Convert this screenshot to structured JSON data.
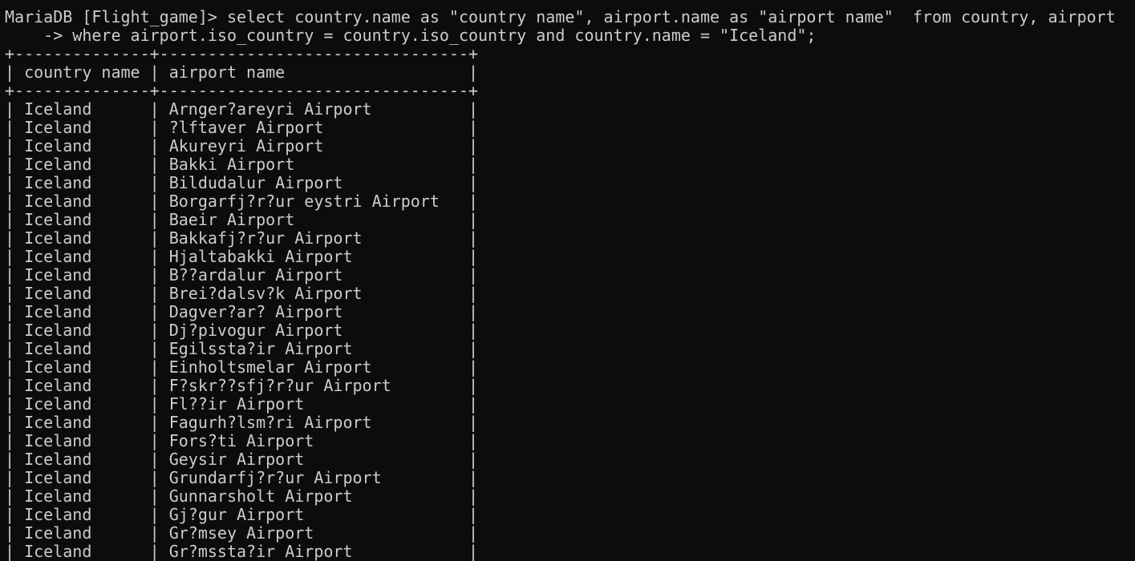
{
  "terminal": {
    "prompt": "MariaDB [Flight_game]>",
    "command_line1": "select country.name as \"country name\", airport.name as \"airport name\"  from country, airport",
    "continuation_prompt": "    ->",
    "command_line2": "where airport.iso_country = country.iso_country and country.name = \"Iceland\";"
  },
  "table": {
    "border": "+--------------+--------------------------------+",
    "headers": [
      "country name",
      "airport name"
    ],
    "rows": [
      [
        "Iceland",
        "Arnger?areyri Airport"
      ],
      [
        "Iceland",
        "?lftaver Airport"
      ],
      [
        "Iceland",
        "Akureyri Airport"
      ],
      [
        "Iceland",
        "Bakki Airport"
      ],
      [
        "Iceland",
        "Bildudalur Airport"
      ],
      [
        "Iceland",
        "Borgarfj?r?ur eystri Airport"
      ],
      [
        "Iceland",
        "Baeir Airport"
      ],
      [
        "Iceland",
        "Bakkafj?r?ur Airport"
      ],
      [
        "Iceland",
        "Hjaltabakki Airport"
      ],
      [
        "Iceland",
        "B??ardalur Airport"
      ],
      [
        "Iceland",
        "Brei?dalsv?k Airport"
      ],
      [
        "Iceland",
        "Dagver?ar? Airport"
      ],
      [
        "Iceland",
        "Dj?pivogur Airport"
      ],
      [
        "Iceland",
        "Egilssta?ir Airport"
      ],
      [
        "Iceland",
        "Einholtsmelar Airport"
      ],
      [
        "Iceland",
        "F?skr??sfj?r?ur Airport"
      ],
      [
        "Iceland",
        "Fl??ir Airport"
      ],
      [
        "Iceland",
        "Fagurh?lsm?ri Airport"
      ],
      [
        "Iceland",
        "Fors?ti Airport"
      ],
      [
        "Iceland",
        "Geysir Airport"
      ],
      [
        "Iceland",
        "Grundarfj?r?ur Airport"
      ],
      [
        "Iceland",
        "Gunnarsholt Airport"
      ],
      [
        "Iceland",
        "Gj?gur Airport"
      ],
      [
        "Iceland",
        "Gr?msey Airport"
      ],
      [
        "Iceland",
        "Gr?mssta?ir Airport"
      ]
    ]
  }
}
